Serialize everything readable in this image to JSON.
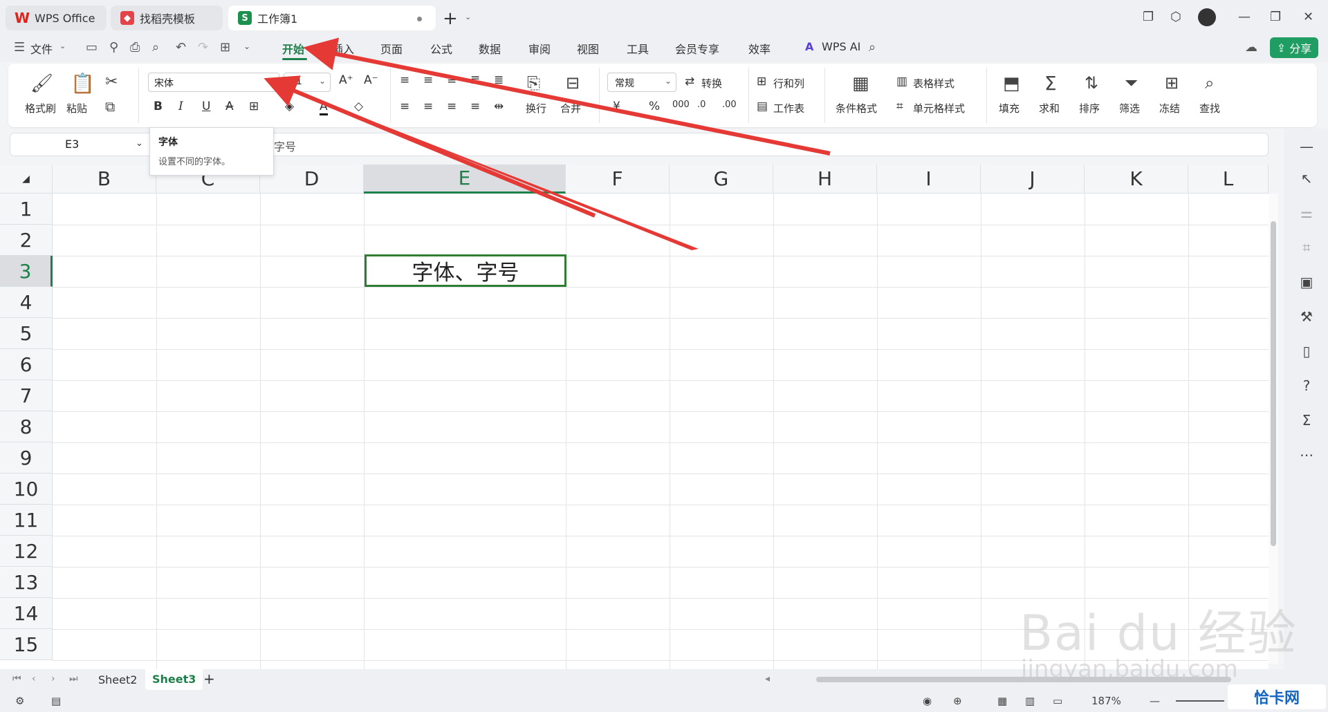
{
  "tabs": {
    "wps": "WPS Office",
    "template": "找稻壳模板",
    "workbook": "工作簿1"
  },
  "menu": {
    "file": "文件",
    "items": [
      "开始",
      "插入",
      "页面",
      "公式",
      "数据",
      "审阅",
      "视图",
      "工具",
      "会员专享",
      "效率"
    ],
    "wps_ai": "WPS AI",
    "share": "分享"
  },
  "ribbon": {
    "format_painter": "格式刷",
    "paste": "粘贴",
    "font_name": "宋体",
    "font_size": "11",
    "wrap": "换行",
    "merge": "合并",
    "number_format": "常规",
    "convert": "转换",
    "row_col": "行和列",
    "worksheet": "工作表",
    "cond_format": "条件格式",
    "table_style": "表格样式",
    "cell_style": "单元格样式",
    "fill": "填充",
    "sum": "求和",
    "sort": "排序",
    "filter": "筛选",
    "freeze": "冻结",
    "find": "查找"
  },
  "tooltip": {
    "title": "字体",
    "desc": "设置不同的字体。"
  },
  "formula_bar": {
    "cell_ref": "E3",
    "content": "字号"
  },
  "grid": {
    "columns": [
      "B",
      "C",
      "D",
      "E",
      "F",
      "G",
      "H",
      "I",
      "J",
      "K",
      "L"
    ],
    "selected_column": "E",
    "rows": [
      "1",
      "2",
      "3",
      "4",
      "5",
      "6",
      "7",
      "8",
      "9",
      "10",
      "11",
      "12",
      "13",
      "14",
      "15"
    ],
    "selected_row": "3",
    "active_cell_text": "字体、字号"
  },
  "sheets": {
    "tabs": [
      "Sheet2",
      "Sheet3"
    ],
    "active": "Sheet3"
  },
  "status": {
    "zoom": "187%"
  },
  "watermark": {
    "main": "Bai du 经验",
    "sub": "jingyan.baidu.com",
    "brand": "恰卡网"
  },
  "colors": {
    "accent": "#1d7f4a",
    "share": "#1f9d63",
    "arrow": "#e53935"
  }
}
